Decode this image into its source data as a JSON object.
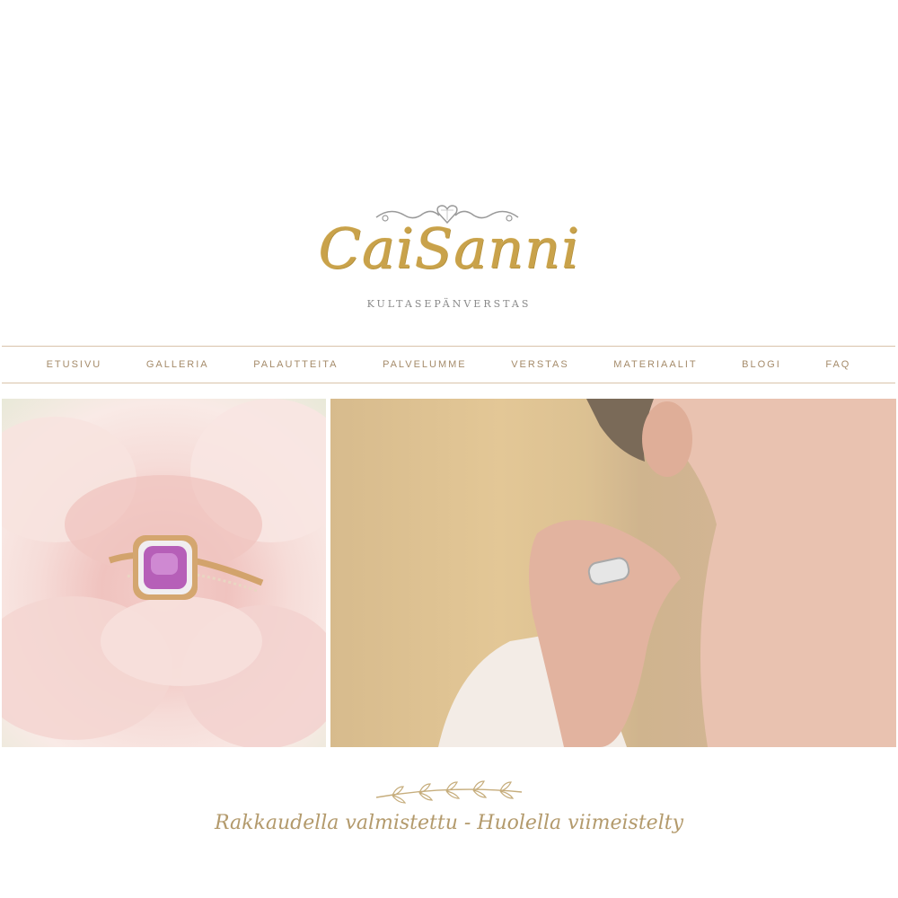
{
  "header": {
    "brand_name": "CaiSanni",
    "brand_subtitle": "KULTASEPÄNVERSTAS"
  },
  "nav": {
    "items": [
      "ETUSIVU",
      "GALLERIA",
      "PALAUTTEITA",
      "PALVELUMME",
      "VERSTAS",
      "MATERIAALIT",
      "BLOGI",
      "FAQ"
    ]
  },
  "hero": {
    "left_image": "pink-sapphire-ring-on-rose",
    "right_image": "woman-wearing-silver-ring"
  },
  "footer": {
    "tagline": "Rakkaudella valmistettu - Huolella viimeistelty"
  },
  "colors": {
    "gold": "#c9a24a",
    "nav_text": "#a58b6a",
    "divider": "#d9c3aa",
    "tagline": "#b39a6c"
  }
}
